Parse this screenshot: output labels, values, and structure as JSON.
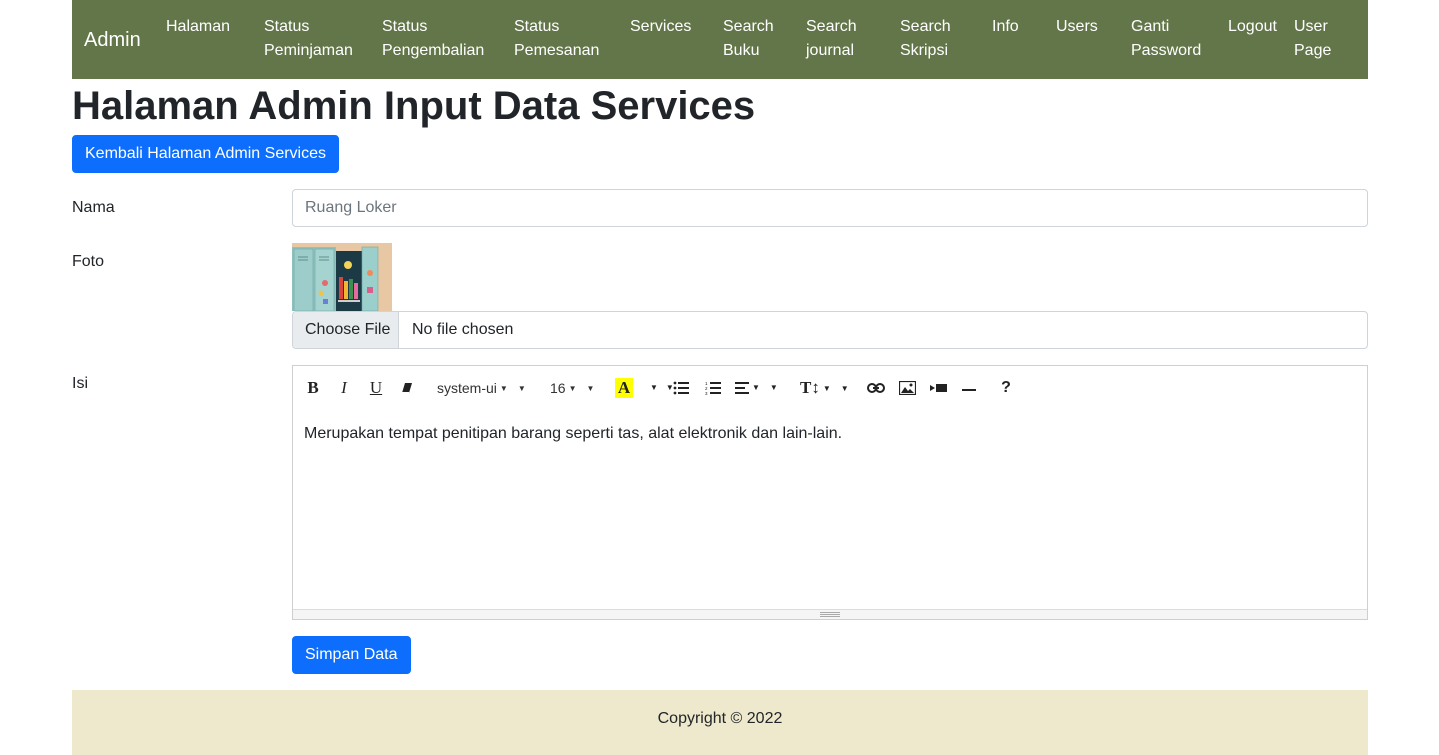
{
  "navbar": {
    "brand": "Admin",
    "items": [
      {
        "label": "Halaman"
      },
      {
        "label": "Status Peminjaman"
      },
      {
        "label": "Status Pengembalian"
      },
      {
        "label": "Status Pemesanan"
      },
      {
        "label": "Services"
      },
      {
        "label": "Search Buku"
      },
      {
        "label": "Search journal"
      },
      {
        "label": "Search Skripsi"
      },
      {
        "label": "Info"
      },
      {
        "label": "Users"
      },
      {
        "label": "Ganti Password"
      },
      {
        "label": "Logout"
      },
      {
        "label": "User Page"
      }
    ],
    "bg_color": "#637649"
  },
  "page": {
    "title": "Halaman Admin Input Data Services",
    "back_button": "Kembali Halaman Admin Services"
  },
  "form": {
    "nama": {
      "label": "Nama",
      "placeholder": "Ruang Loker"
    },
    "foto": {
      "label": "Foto",
      "file_button": "Choose File",
      "file_status": "No file chosen"
    },
    "isi": {
      "label": "Isi",
      "toolbar": {
        "bold": "B",
        "italic": "I",
        "underline": "U",
        "font_family": "system-ui",
        "font_size": "16",
        "color_letter": "A",
        "text_style": "T↕"
      },
      "content": "Merupakan tempat penitipan barang seperti tas, alat elektronik dan lain-lain."
    },
    "submit": "Simpan Data"
  },
  "footer": {
    "text": "Copyright © 2022",
    "bg_color": "#eee8cc"
  },
  "colors": {
    "primary": "#0d6efd"
  }
}
